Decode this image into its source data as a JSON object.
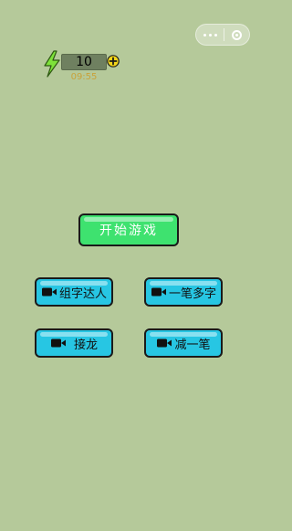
{
  "energy": {
    "value": "10",
    "timer": "09:55",
    "bolt_icon": "lightning-icon",
    "add_icon": "plus-circle-icon"
  },
  "menu": {
    "start_label": "开始游戏",
    "modes": [
      {
        "label": "组字达人",
        "icon": "video-icon"
      },
      {
        "label": "一笔多字",
        "icon": "video-icon"
      },
      {
        "label": "接龙",
        "icon": "video-icon"
      },
      {
        "label": "减一笔",
        "icon": "video-icon"
      }
    ]
  },
  "colors": {
    "background": "#b5c99a",
    "start_button": "#3ee26f",
    "mode_button": "#27c6e3",
    "timer": "#c9a23a",
    "bolt": "#7ee23a",
    "plus": "#f2d51a"
  }
}
